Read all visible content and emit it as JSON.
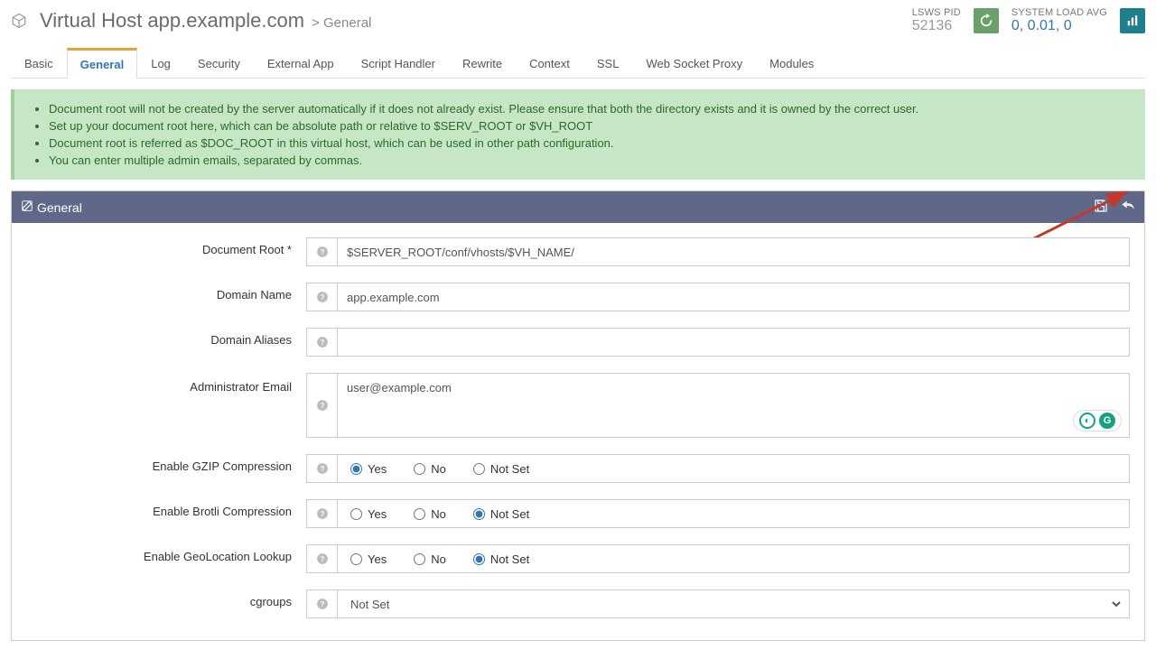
{
  "header": {
    "title_prefix": "Virtual Host app.example.com",
    "crumb_sep": ">",
    "crumb_current": "General",
    "pid_label": "LSWS PID",
    "pid_value": "52136",
    "load_label": "SYSTEM LOAD AVG",
    "load_value": "0, 0.01, 0"
  },
  "tabs": [
    "Basic",
    "General",
    "Log",
    "Security",
    "External App",
    "Script Handler",
    "Rewrite",
    "Context",
    "SSL",
    "Web Socket Proxy",
    "Modules"
  ],
  "active_tab": "General",
  "notice": [
    "Document root will not be created by the server automatically if it does not already exist. Please ensure that both the directory exists and it is owned by the correct user.",
    "Set up your document root here, which can be absolute path or relative to $SERV_ROOT or $VH_ROOT",
    "Document root is referred as $DOC_ROOT in this virtual host, which can be used in other path configuration.",
    "You can enter multiple admin emails, separated by commas."
  ],
  "panel": {
    "title": "General",
    "fields": {
      "doc_root": {
        "label": "Document Root *",
        "value": "$SERVER_ROOT/conf/vhosts/$VH_NAME/"
      },
      "domain_name": {
        "label": "Domain Name",
        "value": "app.example.com"
      },
      "domain_aliases": {
        "label": "Domain Aliases",
        "value": ""
      },
      "admin_email": {
        "label": "Administrator Email",
        "value": "user@example.com"
      },
      "gzip": {
        "label": "Enable GZIP Compression",
        "options": [
          "Yes",
          "No",
          "Not Set"
        ],
        "selected": "Yes"
      },
      "brotli": {
        "label": "Enable Brotli Compression",
        "options": [
          "Yes",
          "No",
          "Not Set"
        ],
        "selected": "Not Set"
      },
      "geo": {
        "label": "Enable GeoLocation Lookup",
        "options": [
          "Yes",
          "No",
          "Not Set"
        ],
        "selected": "Not Set"
      },
      "cgroups": {
        "label": "cgroups",
        "value": "Not Set"
      }
    }
  }
}
